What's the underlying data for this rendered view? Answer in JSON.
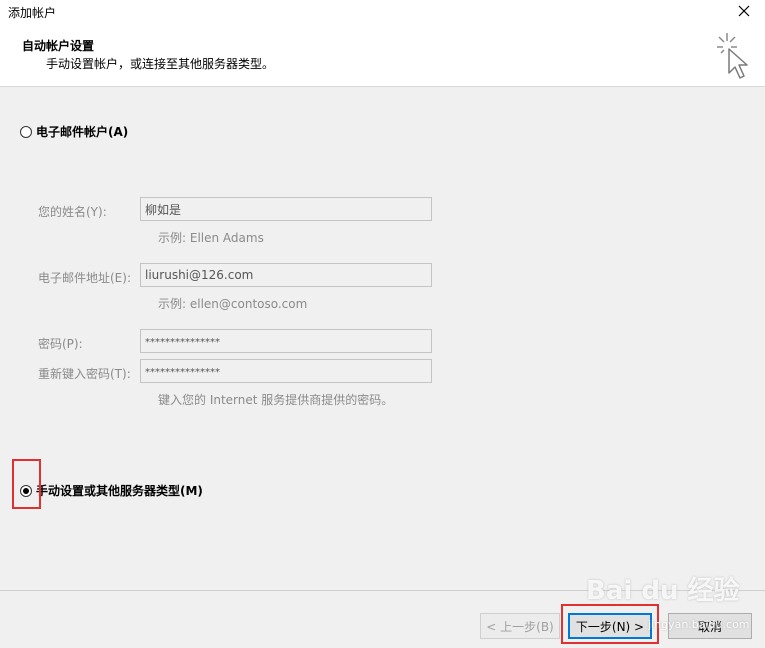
{
  "window": {
    "title": "添加帐户"
  },
  "header": {
    "title": "自动帐户设置",
    "subtitle": "手动设置帐户，或连接至其他服务器类型。"
  },
  "options": {
    "email_account": {
      "label": "电子邮件帐户(A)",
      "checked": false
    },
    "manual_setup": {
      "label": "手动设置或其他服务器类型(M)",
      "checked": true
    }
  },
  "form": {
    "name_label": "您的姓名(Y):",
    "name_value": "柳如是",
    "name_hint": "示例: Ellen Adams",
    "email_label": "电子邮件地址(E):",
    "email_value": "liurushi@126.com",
    "email_hint": "示例: ellen@contoso.com",
    "password_label": "密码(P):",
    "password_value": "***************",
    "retype_label": "重新键入密码(T):",
    "retype_value": "***************",
    "password_hint": "键入您的 Internet 服务提供商提供的密码。"
  },
  "buttons": {
    "back": "< 上一步(B)",
    "next": "下一步(N) >",
    "cancel": "取消"
  },
  "watermark": {
    "main": "Bai du 经验",
    "sub": "jingyan.baidu.com"
  },
  "colors": {
    "highlight": "#e03030",
    "focus": "#0078d7"
  }
}
